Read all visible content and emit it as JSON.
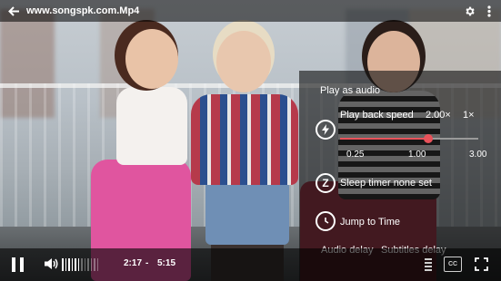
{
  "topbar": {
    "title": "www.songspk.com.Mp4",
    "back_icon": "arrow-left-icon",
    "settings_icon": "gear-icon",
    "more_icon": "vertical-dots-icon"
  },
  "panel": {
    "play_as_audio": "Play as audio",
    "playback_speed_label": "Play back speed",
    "playback_speed_value": "2.00×",
    "playback_speed_alt": "1×",
    "speed_ticks": [
      "0.25",
      "1.00",
      "3.00"
    ],
    "speed_min": 0.25,
    "speed_max": 3.0,
    "speed_current": 2.0,
    "sleep_timer_label": "Sleep timer none set",
    "jump_to_time_label": "Jump to Time",
    "audio_delay_label": "Audio delay",
    "subtitles_delay_label": "Subtitles delay",
    "accent_color": "#e8525a"
  },
  "controls": {
    "current_time": "2:17",
    "separator": "-",
    "total_time": "5:15",
    "volume_level": 0.5,
    "cc_label": "CC"
  }
}
